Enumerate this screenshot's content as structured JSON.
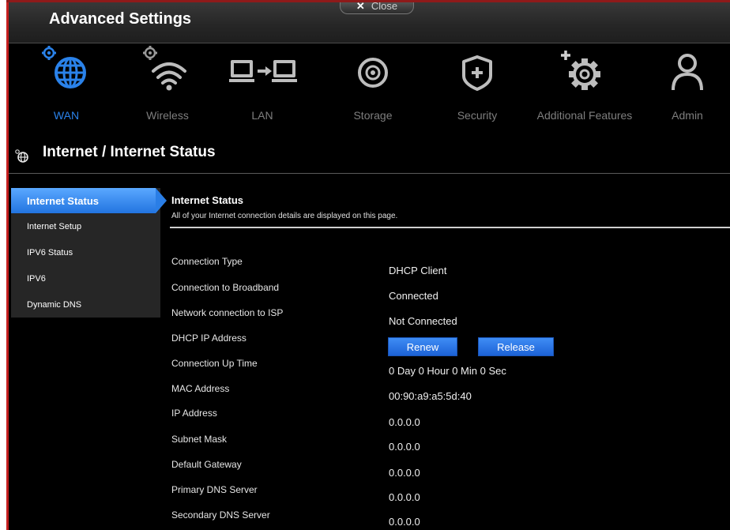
{
  "header": {
    "title": "Advanced Settings",
    "close_label": "Close"
  },
  "nav": {
    "items": [
      {
        "label": "WAN",
        "icon": "globe-icon",
        "active": true
      },
      {
        "label": "Wireless",
        "icon": "wifi-icon"
      },
      {
        "label": "LAN",
        "icon": "lan-icon"
      },
      {
        "label": "Storage",
        "icon": "storage-icon"
      },
      {
        "label": "Security",
        "icon": "shield-icon"
      },
      {
        "label": "Additional Features",
        "icon": "gear-plus-icon"
      },
      {
        "label": "Admin",
        "icon": "user-icon"
      }
    ]
  },
  "page": {
    "title": "Internet / Internet Status"
  },
  "sidebar": {
    "items": [
      {
        "label": "Internet Status",
        "active": true
      },
      {
        "label": "Internet Setup"
      },
      {
        "label": "IPV6 Status"
      },
      {
        "label": "IPV6"
      },
      {
        "label": "Dynamic DNS"
      }
    ]
  },
  "content": {
    "title": "Internet Status",
    "subtitle": "All of your Internet connection details are displayed on this page.",
    "fields": [
      {
        "label": "Connection Type",
        "value": "DHCP Client"
      },
      {
        "label": "Connection to Broadband",
        "value": "Connected"
      },
      {
        "label": "Network connection to ISP",
        "value": "Not Connected"
      },
      {
        "label": "DHCP IP Address",
        "value": ""
      },
      {
        "label": "Connection Up Time",
        "value": "0 Day 0 Hour 0 Min 0 Sec"
      },
      {
        "label": "MAC Address",
        "value": "00:90:a9:a5:5d:40"
      },
      {
        "label": "IP Address",
        "value": "0.0.0.0"
      },
      {
        "label": "Subnet Mask",
        "value": "0.0.0.0"
      },
      {
        "label": "Default Gateway",
        "value": "0.0.0.0"
      },
      {
        "label": "Primary DNS Server",
        "value": "0.0.0.0"
      },
      {
        "label": "Secondary DNS Server",
        "value": "0.0.0.0"
      }
    ],
    "renew_label": "Renew",
    "release_label": "Release"
  },
  "colors": {
    "accent": "#2a82ea",
    "background": "#000000",
    "inactive_label": "#7e7e7e"
  }
}
